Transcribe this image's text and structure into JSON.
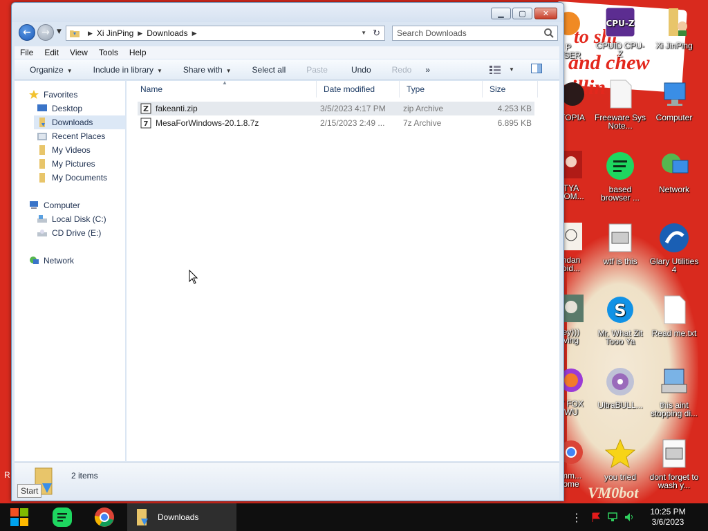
{
  "window": {
    "title_buttons": {
      "minimize": "▁",
      "maximize": "▢",
      "close": "✕"
    }
  },
  "address": {
    "crumbs": [
      "Xi JinPing",
      "Downloads"
    ],
    "search_placeholder": "Search Downloads"
  },
  "menu": [
    "File",
    "Edit",
    "View",
    "Tools",
    "Help"
  ],
  "toolbar": {
    "organize": "Organize",
    "include_in_library": "Include in library",
    "share_with": "Share with",
    "select_all": "Select all",
    "paste": "Paste",
    "undo": "Undo",
    "redo": "Redo",
    "more": "»"
  },
  "nav": {
    "favorites": "Favorites",
    "desktop": "Desktop",
    "downloads": "Downloads",
    "recent_places": "Recent Places",
    "my_videos": "My Videos",
    "my_pictures": "My Pictures",
    "my_documents": "My Documents",
    "computer": "Computer",
    "local_disk": "Local Disk (C:)",
    "cd_drive": "CD Drive (E:)",
    "network": "Network"
  },
  "columns": {
    "name": "Name",
    "date": "Date modified",
    "type": "Type",
    "size": "Size"
  },
  "files": [
    {
      "name": "fakeanti.zip",
      "date": "3/5/2023 4:17 PM",
      "type": "zip Archive",
      "size": "4.253 KB"
    },
    {
      "name": "MesaForWindows-20.1.8.7z",
      "date": "2/15/2023 2:49 ...",
      "type": "7z Archive",
      "size": "6.895 KB"
    }
  ],
  "details": {
    "item_count": "2 items",
    "start_tip": "Start"
  },
  "desktop_icons": {
    "cpuz": "CPUID CPU-Z",
    "xijinping": "Xi JinPing",
    "browser_partial": "P\nWSER",
    "freeware": "Freeware Sys Note...",
    "computer": "Computer",
    "topia": "TOPIA",
    "based_browser": "based browser ...",
    "network": "Network",
    "tya": "TYA\nSOM...",
    "wtf": "wtf is this",
    "glary": "Glary Utilities 4",
    "ndan": "ndan\noid...",
    "mr_what": "Mr. What Zit Tooo Ya",
    "readme": "Read me.txt",
    "ey": "ey)))\nving",
    "ultrabull": "UltraBULL...",
    "aint": "this aint stopping di...",
    "fox": "Y FOX\nWU",
    "you_tried": "you tried",
    "wash": "dont forget to wash y...",
    "mm": "mm...\nome",
    "left_r": "R"
  },
  "taskbar": {
    "downloads_label": "Downloads",
    "time": "10:25 PM",
    "date": "3/6/2023"
  },
  "colors": {
    "desktop_red": "#d92a1e",
    "window_frame": "#dbe6f3",
    "taskbar": "#0f0f0f"
  }
}
